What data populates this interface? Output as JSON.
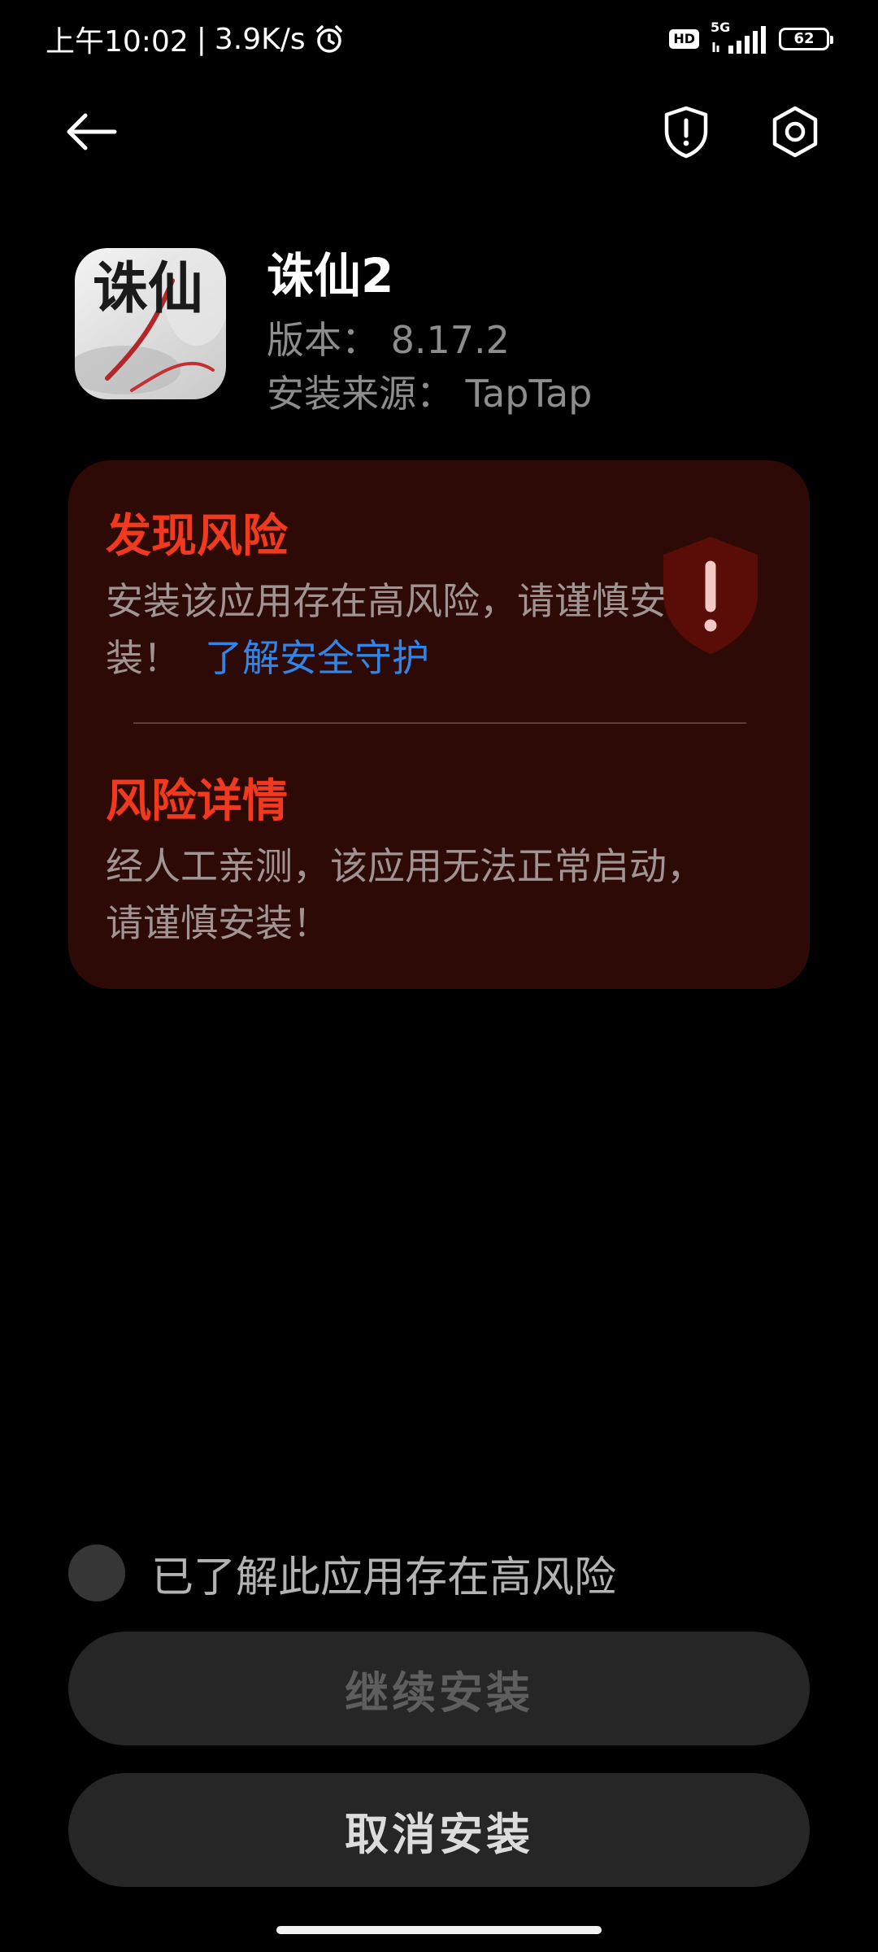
{
  "status_bar": {
    "time": "上午10:02",
    "separator": "|",
    "net_speed": "3.9K/s",
    "hd_label": "HD",
    "network": "5G",
    "battery": "62",
    "icons": [
      "alarm-icon",
      "signal-icon",
      "battery-icon"
    ]
  },
  "nav": {
    "icons": [
      "back-arrow-icon",
      "shield-alert-icon",
      "settings-hexagon-icon"
    ]
  },
  "app": {
    "name": "诛仙2",
    "version_line": "版本：  8.17.2",
    "source_line": "安装来源：  TapTap",
    "icon_glyph": "诛仙"
  },
  "risk_card": {
    "found_title": "发现风险",
    "found_text": "安装该应用存在高风险，请谨慎安装！",
    "learn_link": "了解安全守护",
    "detail_title": "风险详情",
    "detail_text": "经人工亲测，该应用无法正常启动，请谨慎安装！",
    "badge_icon": "shield-warning-icon"
  },
  "actions": {
    "ack_label": "已了解此应用存在高风险",
    "continue_label": "继续安装",
    "cancel_label": "取消安装"
  },
  "colors": {
    "background": "#000000",
    "card": "#2d0a06",
    "danger": "#f0391f",
    "link": "#2f86e8",
    "button": "#262626"
  }
}
